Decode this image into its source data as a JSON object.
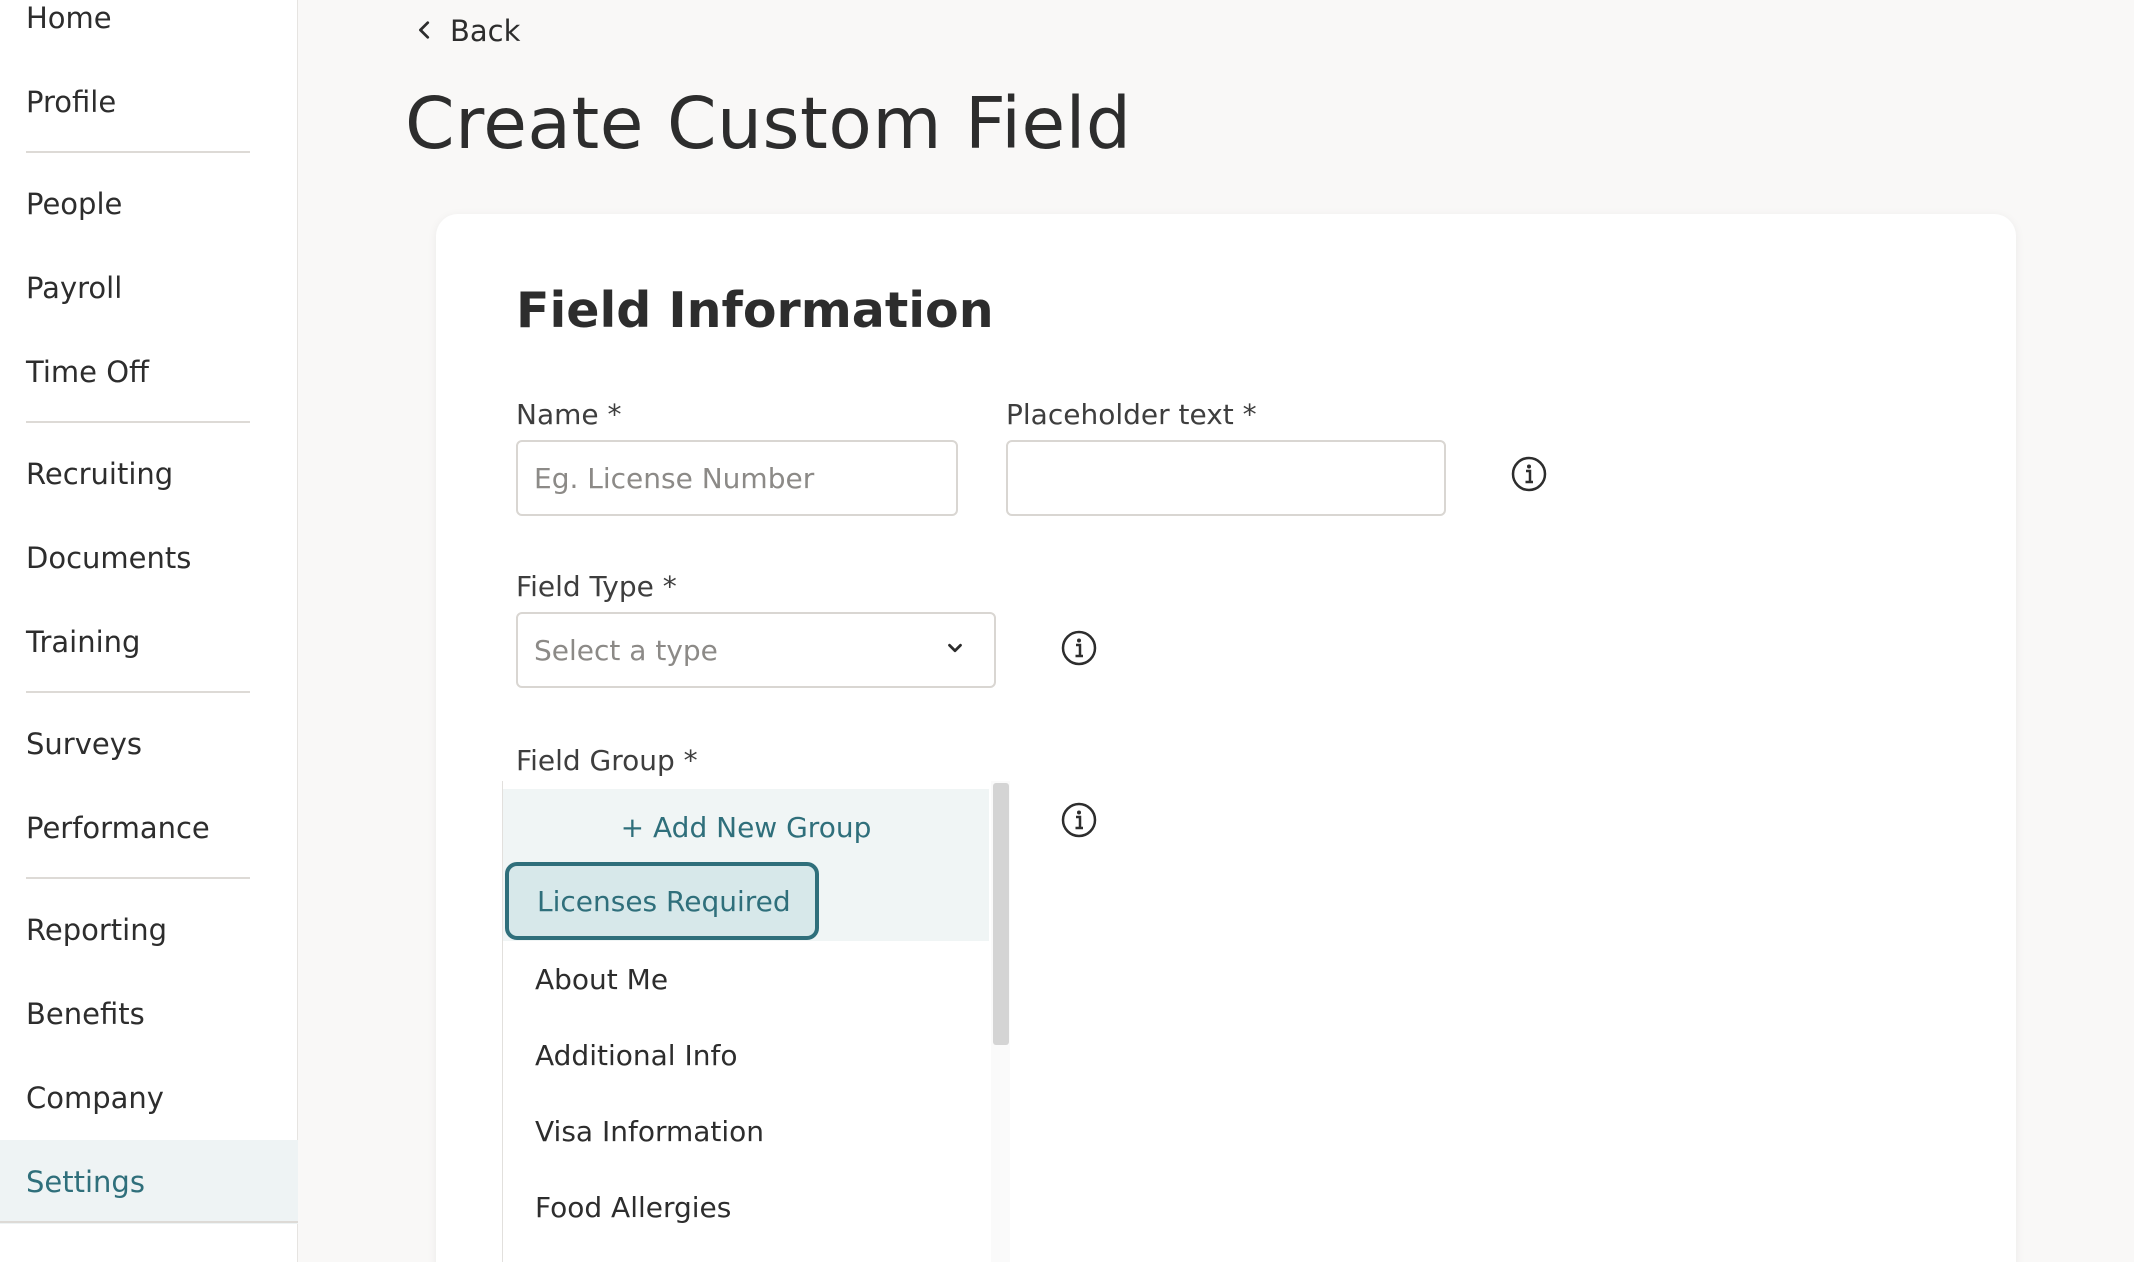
{
  "sidebar": {
    "items": [
      {
        "label": "Home"
      },
      {
        "label": "Profile"
      },
      {
        "label": "People"
      },
      {
        "label": "Payroll"
      },
      {
        "label": "Time Off"
      },
      {
        "label": "Recruiting"
      },
      {
        "label": "Documents"
      },
      {
        "label": "Training"
      },
      {
        "label": "Surveys"
      },
      {
        "label": "Performance"
      },
      {
        "label": "Reporting"
      },
      {
        "label": "Benefits"
      },
      {
        "label": "Company"
      },
      {
        "label": "Settings",
        "active": true
      }
    ]
  },
  "header": {
    "back_label": "Back",
    "title": "Create Custom Field"
  },
  "form": {
    "section_title": "Field Information",
    "name": {
      "label": "Name *",
      "placeholder": "Eg. License Number",
      "value": ""
    },
    "placeholder_text": {
      "label": "Placeholder text *",
      "value": ""
    },
    "field_type": {
      "label": "Field Type *",
      "placeholder": "Select a type"
    },
    "field_group": {
      "label": "Field Group *"
    }
  },
  "dropdown": {
    "add_label": "+ Add New Group",
    "selected": "Licenses Required",
    "options": [
      "About Me",
      "Additional Info",
      "Visa Information",
      "Food Allergies"
    ]
  },
  "colors": {
    "accent": "#2f6f7b",
    "selected_bg": "#d7e8ea",
    "hover_bg": "#f0f5f5"
  },
  "icons": {
    "back": "chevron-left-icon",
    "select": "chevron-down-icon",
    "info": "info-circle-icon"
  }
}
